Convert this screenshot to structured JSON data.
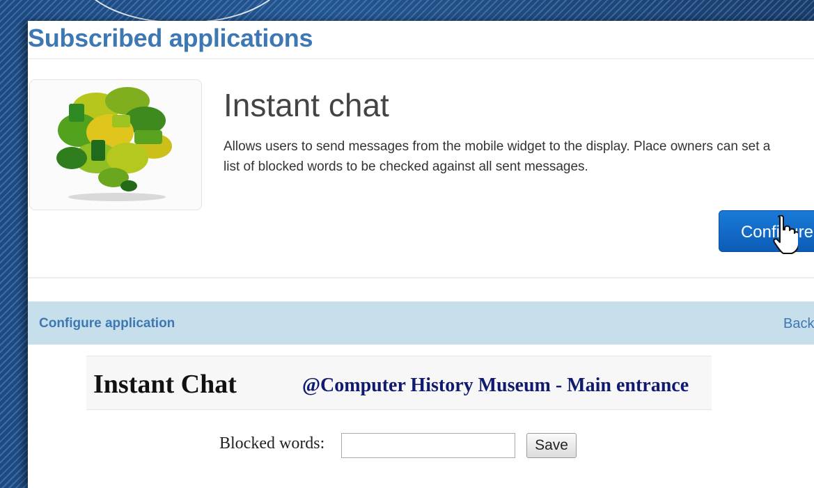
{
  "page": {
    "title": "Subscribed applications"
  },
  "app": {
    "name": "Instant chat",
    "description": "Allows users to send messages from the mobile widget to the display. Place owners can set a list of blocked words to be checked against all sent messages.",
    "image_icon": "speech-bubbles-cluster-icon",
    "configure_label": "Configure"
  },
  "config_bar": {
    "label": "Configure application",
    "back_label": "Back"
  },
  "chat_panel": {
    "title": "Instant Chat",
    "location": "@Computer History Museum - Main entrance"
  },
  "blocked_words": {
    "label": "Blocked words:",
    "value": "",
    "save_label": "Save"
  },
  "colors": {
    "accent": "#3d78b5",
    "button": "#0c5cb6",
    "bar": "#c7dfeb",
    "location_text": "#101a6e"
  },
  "cursor_icon": "hand-pointer-icon"
}
